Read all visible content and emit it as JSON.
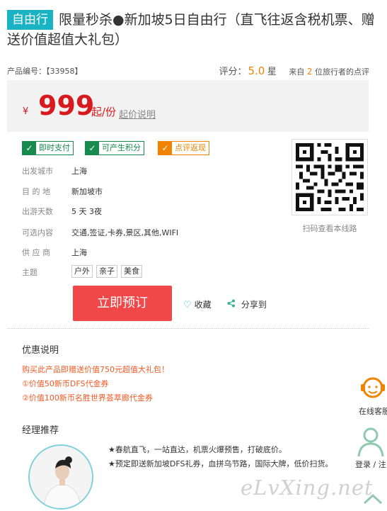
{
  "product": {
    "tag": "自由行",
    "title": "限量秒杀●新加坡5日自由行（直飞往返含税机票、赠送价值超值大礼包）",
    "code": "产品编号：【33958】",
    "rating_label": "评分：",
    "rating_score": "5.0",
    "rating_star": "星",
    "review_prefix": "来自",
    "review_count": "2",
    "review_suffix": "位旅行者的点评"
  },
  "price": {
    "currency": "¥",
    "amount": "999",
    "unit": "起/份",
    "note": "起价说明"
  },
  "badges": [
    {
      "label": "即时支付",
      "check": "✓"
    },
    {
      "label": "可产生积分",
      "check": "✓"
    },
    {
      "label": "点评返现",
      "check": "✓"
    }
  ],
  "info": {
    "depart_label": "出发城市",
    "depart": "上海",
    "dest_label": "目 的 地",
    "dest": "新加坡市",
    "days_label": "出游天数",
    "days": "5 天 3夜",
    "options_label": "可选内容",
    "options": "交通,签证,卡券,景区,其他,WIFI",
    "supplier_label": "供 应 商",
    "supplier": "上海",
    "theme_label": "主题",
    "themes": [
      "户外",
      "亲子",
      "美食"
    ]
  },
  "qr": {
    "caption": "扫码查看本线路",
    "icon": "qr-code"
  },
  "actions": {
    "book": "立即预订",
    "favorite": "收藏",
    "favorite_icon": "♡",
    "share": "分享到"
  },
  "promo": {
    "title": "优惠说明",
    "lines": [
      "购买此产品即赠送价值750元超值大礼包！",
      "①价值50新币DFS代金券",
      "②价值100新币名胜世界荟萃廊代金券"
    ]
  },
  "manager": {
    "title": "经理推荐",
    "lines": [
      "★春航直飞，一站直达，机票火爆预售，打破底价。",
      "★预定即送新加坡DFS礼券，血拼乌节路，国际大牌，低价扫货。"
    ]
  },
  "sidebar": {
    "cs_label": "在线客服",
    "login_label": "登录 / 注"
  },
  "watermark": "eLvXing.net",
  "colors": {
    "accent": "#1ab3c3",
    "price": "#d8191d",
    "book": "#f04748",
    "promo": "#f05a24",
    "green": "#168b4d",
    "orange": "#f08300"
  }
}
